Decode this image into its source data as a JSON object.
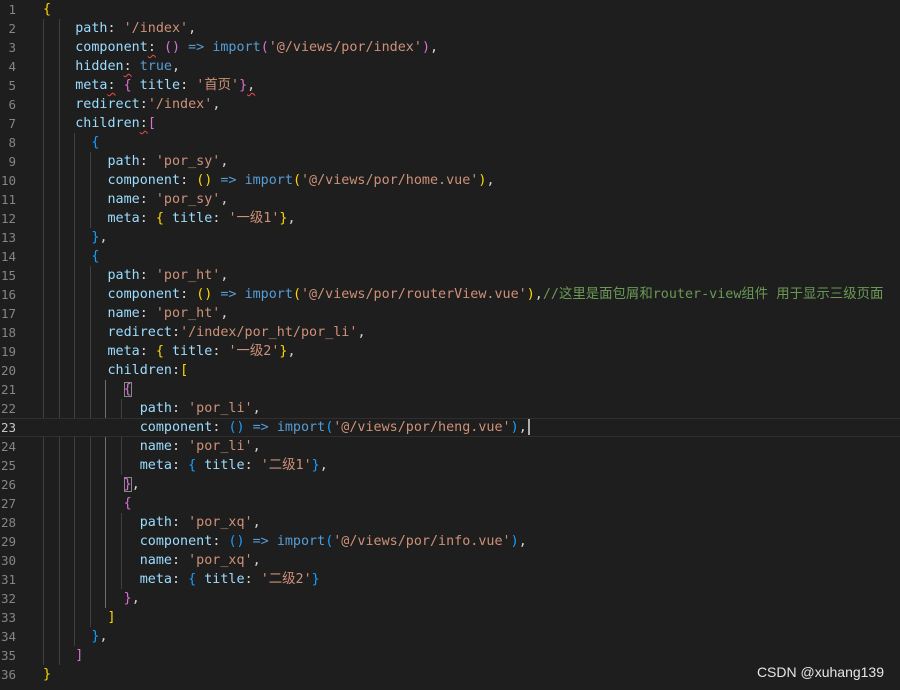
{
  "editor": {
    "current_line": 23,
    "lines": [
      {
        "n": "1",
        "tokens": [
          {
            "t": "{",
            "c": "b1"
          }
        ]
      },
      {
        "n": "2",
        "tokens": [
          {
            "t": "    "
          },
          {
            "t": "path",
            "c": "t-p"
          },
          {
            "t": ": "
          },
          {
            "t": "'/index'",
            "c": "t-s"
          },
          {
            "t": ","
          }
        ]
      },
      {
        "n": "3",
        "tokens": [
          {
            "t": "    "
          },
          {
            "t": "component",
            "c": "t-p"
          },
          {
            "t": ":",
            "sq": true
          },
          {
            "t": " "
          },
          {
            "t": "()",
            "c": "b2"
          },
          {
            "t": " "
          },
          {
            "t": "=>",
            "c": "t-k"
          },
          {
            "t": " "
          },
          {
            "t": "import",
            "c": "t-k"
          },
          {
            "t": "(",
            "c": "b2"
          },
          {
            "t": "'@/views/por/index'",
            "c": "t-s"
          },
          {
            "t": ")",
            "c": "b2"
          },
          {
            "t": ","
          }
        ]
      },
      {
        "n": "4",
        "tokens": [
          {
            "t": "    "
          },
          {
            "t": "hidden",
            "c": "t-p"
          },
          {
            "t": ":",
            "sq": true
          },
          {
            "t": " "
          },
          {
            "t": "true",
            "c": "t-k"
          },
          {
            "t": ","
          }
        ]
      },
      {
        "n": "5",
        "tokens": [
          {
            "t": "    "
          },
          {
            "t": "meta",
            "c": "t-p"
          },
          {
            "t": ":",
            "sq": true
          },
          {
            "t": " "
          },
          {
            "t": "{",
            "c": "b2"
          },
          {
            "t": " "
          },
          {
            "t": "title",
            "c": "t-p"
          },
          {
            "t": ": "
          },
          {
            "t": "'首页'",
            "c": "t-s"
          },
          {
            "t": "}",
            "c": "b2"
          },
          {
            "t": ",",
            "sq": true
          }
        ]
      },
      {
        "n": "6",
        "tokens": [
          {
            "t": "    "
          },
          {
            "t": "redirect",
            "c": "t-p"
          },
          {
            "t": ":"
          },
          {
            "t": "'/index'",
            "c": "t-s"
          },
          {
            "t": ","
          }
        ]
      },
      {
        "n": "7",
        "tokens": [
          {
            "t": "    "
          },
          {
            "t": "children",
            "c": "t-p"
          },
          {
            "t": ":",
            "sq": true
          },
          {
            "t": "[",
            "c": "b2"
          }
        ]
      },
      {
        "n": "8",
        "tokens": [
          {
            "t": "      "
          },
          {
            "t": "{",
            "c": "b3"
          }
        ]
      },
      {
        "n": "9",
        "tokens": [
          {
            "t": "        "
          },
          {
            "t": "path",
            "c": "t-p"
          },
          {
            "t": ": "
          },
          {
            "t": "'por_sy'",
            "c": "t-s"
          },
          {
            "t": ","
          }
        ]
      },
      {
        "n": "10",
        "tokens": [
          {
            "t": "        "
          },
          {
            "t": "component",
            "c": "t-p"
          },
          {
            "t": ": "
          },
          {
            "t": "()",
            "c": "b1"
          },
          {
            "t": " "
          },
          {
            "t": "=>",
            "c": "t-k"
          },
          {
            "t": " "
          },
          {
            "t": "import",
            "c": "t-k"
          },
          {
            "t": "(",
            "c": "b1"
          },
          {
            "t": "'@/views/por/home.vue'",
            "c": "t-s"
          },
          {
            "t": ")",
            "c": "b1"
          },
          {
            "t": ","
          }
        ]
      },
      {
        "n": "11",
        "tokens": [
          {
            "t": "        "
          },
          {
            "t": "name",
            "c": "t-p"
          },
          {
            "t": ": "
          },
          {
            "t": "'por_sy'",
            "c": "t-s"
          },
          {
            "t": ","
          }
        ]
      },
      {
        "n": "12",
        "tokens": [
          {
            "t": "        "
          },
          {
            "t": "meta",
            "c": "t-p"
          },
          {
            "t": ": "
          },
          {
            "t": "{",
            "c": "b1"
          },
          {
            "t": " "
          },
          {
            "t": "title",
            "c": "t-p"
          },
          {
            "t": ": "
          },
          {
            "t": "'一级1'",
            "c": "t-s"
          },
          {
            "t": "}",
            "c": "b1"
          },
          {
            "t": ","
          }
        ]
      },
      {
        "n": "13",
        "tokens": [
          {
            "t": "      "
          },
          {
            "t": "}",
            "c": "b3"
          },
          {
            "t": ","
          }
        ]
      },
      {
        "n": "14",
        "tokens": [
          {
            "t": "      "
          },
          {
            "t": "{",
            "c": "b3"
          }
        ]
      },
      {
        "n": "15",
        "tokens": [
          {
            "t": "        "
          },
          {
            "t": "path",
            "c": "t-p"
          },
          {
            "t": ": "
          },
          {
            "t": "'por_ht'",
            "c": "t-s"
          },
          {
            "t": ","
          }
        ]
      },
      {
        "n": "16",
        "tokens": [
          {
            "t": "        "
          },
          {
            "t": "component",
            "c": "t-p"
          },
          {
            "t": ": "
          },
          {
            "t": "()",
            "c": "b1"
          },
          {
            "t": " "
          },
          {
            "t": "=>",
            "c": "t-k"
          },
          {
            "t": " "
          },
          {
            "t": "import",
            "c": "t-k"
          },
          {
            "t": "(",
            "c": "b1"
          },
          {
            "t": "'@/views/por/routerView.vue'",
            "c": "t-s"
          },
          {
            "t": ")",
            "c": "b1"
          },
          {
            "t": ","
          },
          {
            "t": "//这里是面包屑和router-view组件 用于显示三级页面",
            "c": "t-c"
          }
        ]
      },
      {
        "n": "17",
        "tokens": [
          {
            "t": "        "
          },
          {
            "t": "name",
            "c": "t-p"
          },
          {
            "t": ": "
          },
          {
            "t": "'por_ht'",
            "c": "t-s"
          },
          {
            "t": ","
          }
        ]
      },
      {
        "n": "18",
        "tokens": [
          {
            "t": "        "
          },
          {
            "t": "redirect",
            "c": "t-p"
          },
          {
            "t": ":"
          },
          {
            "t": "'/index/por_ht/por_li'",
            "c": "t-s"
          },
          {
            "t": ","
          }
        ]
      },
      {
        "n": "19",
        "tokens": [
          {
            "t": "        "
          },
          {
            "t": "meta",
            "c": "t-p"
          },
          {
            "t": ": "
          },
          {
            "t": "{",
            "c": "b1"
          },
          {
            "t": " "
          },
          {
            "t": "title",
            "c": "t-p"
          },
          {
            "t": ": "
          },
          {
            "t": "'一级2'",
            "c": "t-s"
          },
          {
            "t": "}",
            "c": "b1"
          },
          {
            "t": ","
          }
        ]
      },
      {
        "n": "20",
        "tokens": [
          {
            "t": "        "
          },
          {
            "t": "children",
            "c": "t-p"
          },
          {
            "t": ":"
          },
          {
            "t": "[",
            "c": "b1"
          }
        ]
      },
      {
        "n": "21",
        "tokens": [
          {
            "t": "          "
          },
          {
            "t": "{",
            "c": "b2",
            "box": true
          }
        ]
      },
      {
        "n": "22",
        "tokens": [
          {
            "t": "            "
          },
          {
            "t": "path",
            "c": "t-p"
          },
          {
            "t": ": "
          },
          {
            "t": "'por_li'",
            "c": "t-s"
          },
          {
            "t": ","
          }
        ]
      },
      {
        "n": "23",
        "tokens": [
          {
            "t": "            "
          },
          {
            "t": "component",
            "c": "t-p"
          },
          {
            "t": ": "
          },
          {
            "t": "()",
            "c": "b3"
          },
          {
            "t": " "
          },
          {
            "t": "=>",
            "c": "t-k"
          },
          {
            "t": " "
          },
          {
            "t": "import",
            "c": "t-k"
          },
          {
            "t": "(",
            "c": "b3"
          },
          {
            "t": "'@/views/por/heng.vue'",
            "c": "t-s"
          },
          {
            "t": ")",
            "c": "b3"
          },
          {
            "t": ","
          },
          {
            "cursor": true
          }
        ]
      },
      {
        "n": "24",
        "tokens": [
          {
            "t": "            "
          },
          {
            "t": "name",
            "c": "t-p"
          },
          {
            "t": ": "
          },
          {
            "t": "'por_li'",
            "c": "t-s"
          },
          {
            "t": ","
          }
        ]
      },
      {
        "n": "25",
        "tokens": [
          {
            "t": "            "
          },
          {
            "t": "meta",
            "c": "t-p"
          },
          {
            "t": ": "
          },
          {
            "t": "{",
            "c": "b3"
          },
          {
            "t": " "
          },
          {
            "t": "title",
            "c": "t-p"
          },
          {
            "t": ": "
          },
          {
            "t": "'二级1'",
            "c": "t-s"
          },
          {
            "t": "}",
            "c": "b3"
          },
          {
            "t": ","
          }
        ]
      },
      {
        "n": "26",
        "tokens": [
          {
            "t": "          "
          },
          {
            "t": "}",
            "c": "b2",
            "box": true
          },
          {
            "t": ","
          }
        ]
      },
      {
        "n": "27",
        "tokens": [
          {
            "t": "          "
          },
          {
            "t": "{",
            "c": "b2"
          }
        ]
      },
      {
        "n": "28",
        "tokens": [
          {
            "t": "            "
          },
          {
            "t": "path",
            "c": "t-p"
          },
          {
            "t": ": "
          },
          {
            "t": "'por_xq'",
            "c": "t-s"
          },
          {
            "t": ","
          }
        ]
      },
      {
        "n": "29",
        "tokens": [
          {
            "t": "            "
          },
          {
            "t": "component",
            "c": "t-p"
          },
          {
            "t": ": "
          },
          {
            "t": "()",
            "c": "b3"
          },
          {
            "t": " "
          },
          {
            "t": "=>",
            "c": "t-k"
          },
          {
            "t": " "
          },
          {
            "t": "import",
            "c": "t-k"
          },
          {
            "t": "(",
            "c": "b3"
          },
          {
            "t": "'@/views/por/info.vue'",
            "c": "t-s"
          },
          {
            "t": ")",
            "c": "b3"
          },
          {
            "t": ","
          }
        ]
      },
      {
        "n": "30",
        "tokens": [
          {
            "t": "            "
          },
          {
            "t": "name",
            "c": "t-p"
          },
          {
            "t": ": "
          },
          {
            "t": "'por_xq'",
            "c": "t-s"
          },
          {
            "t": ","
          }
        ]
      },
      {
        "n": "31",
        "tokens": [
          {
            "t": "            "
          },
          {
            "t": "meta",
            "c": "t-p"
          },
          {
            "t": ": "
          },
          {
            "t": "{",
            "c": "b3"
          },
          {
            "t": " "
          },
          {
            "t": "title",
            "c": "t-p"
          },
          {
            "t": ": "
          },
          {
            "t": "'二级2'",
            "c": "t-s"
          },
          {
            "t": "}",
            "c": "b3"
          }
        ]
      },
      {
        "n": "32",
        "tokens": [
          {
            "t": "          "
          },
          {
            "t": "}",
            "c": "b2"
          },
          {
            "t": ","
          }
        ]
      },
      {
        "n": "33",
        "tokens": [
          {
            "t": "        "
          },
          {
            "t": "]",
            "c": "b1"
          }
        ]
      },
      {
        "n": "34",
        "tokens": [
          {
            "t": "      "
          },
          {
            "t": "}",
            "c": "b3"
          },
          {
            "t": ","
          }
        ]
      },
      {
        "n": "35",
        "tokens": [
          {
            "t": "    "
          },
          {
            "t": "]",
            "c": "b2"
          }
        ]
      },
      {
        "n": "36",
        "tokens": [
          {
            "t": "}",
            "c": "b1"
          }
        ]
      }
    ]
  },
  "watermark": "CSDN @xuhang139",
  "colors": {
    "background": "#1e1e1e",
    "property": "#9cdcfe",
    "string": "#ce9178",
    "keyword": "#569cd6",
    "comment": "#6a9955",
    "bracket_gold": "#ffd700",
    "bracket_orchid": "#da70d6",
    "bracket_blue": "#179fff"
  }
}
